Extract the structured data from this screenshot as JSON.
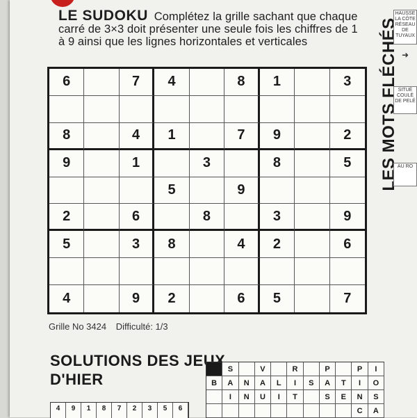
{
  "header": {
    "title": "LE SUDOKU",
    "instructions": "Complétez la grille sachant que chaque carré de 3×3 doit présenter une seule fois les chiffres de 1 à 9 ainsi que les lignes horizontales et verticales"
  },
  "sudoku": {
    "rows": [
      [
        "6",
        "",
        "7",
        "4",
        "",
        "8",
        "1",
        "",
        "3"
      ],
      [
        "",
        "",
        "",
        "",
        "",
        "",
        "",
        "",
        ""
      ],
      [
        "8",
        "",
        "4",
        "1",
        "",
        "7",
        "9",
        "",
        "2"
      ],
      [
        "9",
        "",
        "1",
        "",
        "3",
        "",
        "8",
        "",
        "5"
      ],
      [
        "",
        "",
        "",
        "5",
        "",
        "9",
        "",
        "",
        ""
      ],
      [
        "2",
        "",
        "6",
        "",
        "8",
        "",
        "3",
        "",
        "9"
      ],
      [
        "5",
        "",
        "3",
        "8",
        "",
        "4",
        "2",
        "",
        "6"
      ],
      [
        "",
        "",
        "",
        "",
        "",
        "",
        "",
        "",
        ""
      ],
      [
        "4",
        "",
        "9",
        "2",
        "",
        "6",
        "5",
        "",
        "7"
      ]
    ]
  },
  "footer": {
    "grid_number": "Grille No 3424",
    "difficulty": "Difficulté: 1/3"
  },
  "side": {
    "title": "LES MOTS FLÉCHÉS",
    "clues": [
      "HAUSSE LA CÔTE RÉSEAU DE TUYAUX",
      "SITUÉ COULÉ DE PELÉ",
      "AU RO"
    ]
  },
  "solutions": {
    "title_line1": "SOLUTIONS  DES JEUX",
    "title_line2": "D'HIER",
    "crossword_rows": [
      [
        "#",
        "S",
        "",
        "V",
        "",
        "R",
        "",
        "P",
        "",
        "P",
        "I"
      ],
      [
        "B",
        "A",
        "N",
        "A",
        "L",
        "I",
        "S",
        "A",
        "T",
        "I",
        "O"
      ],
      [
        "",
        "I",
        "N",
        "U",
        "I",
        "T",
        "",
        "S",
        "E",
        "N",
        "S"
      ],
      [
        "",
        "",
        "",
        "",
        "",
        "",
        "",
        "",
        "",
        "C",
        "A"
      ]
    ],
    "sudoku_strip": [
      "4",
      "9",
      "1",
      "8",
      "7",
      "2",
      "3",
      "5",
      "6"
    ]
  }
}
